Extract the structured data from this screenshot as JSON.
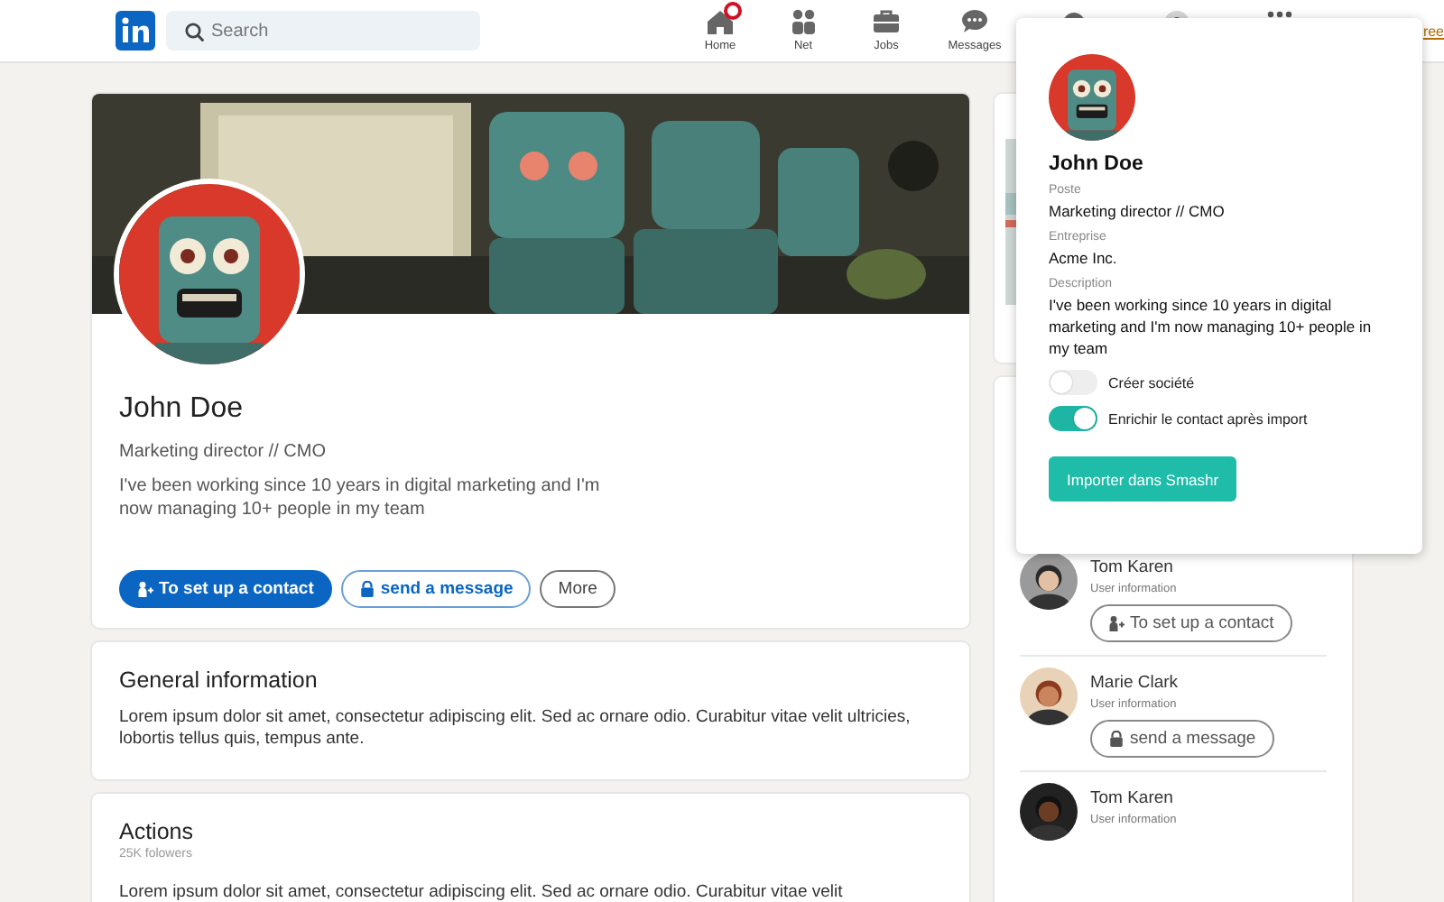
{
  "topbar": {
    "search": {
      "placeholder": "Search"
    },
    "nav_items": [
      {
        "kind": "home",
        "label": "Home",
        "notification": true
      },
      {
        "kind": "people",
        "label": "Net",
        "notification": false
      },
      {
        "kind": "briefcase",
        "label": "Jobs",
        "notification": false
      },
      {
        "kind": "chat",
        "label": "Messages",
        "notification": false
      },
      {
        "kind": "dot",
        "notification": false
      },
      {
        "kind": "avatar",
        "notification": false
      },
      {
        "kind": "grid",
        "notification": false
      }
    ],
    "link": "ree"
  },
  "profile": {
    "name": "John Doe",
    "headline": "Marketing director // CMO",
    "about": "I've been working since 10 years in digital marketing and I'm now managing 10+ people in my team",
    "buttons": [
      {
        "kind": "primary",
        "label": "To set up a contact"
      },
      {
        "kind": "outline",
        "label": "send a message"
      },
      {
        "kind": "plain",
        "label": "More"
      }
    ]
  },
  "sections": [
    {
      "title": "General information",
      "text": "Lorem ipsum dolor sit amet, consectetur adipiscing elit. Sed ac ornare odio. Curabitur vitae velit ultricies, lobortis tellus quis, tempus ante."
    },
    {
      "title": "Actions",
      "subtitle": "25K folowers",
      "text": "Lorem ipsum dolor sit amet, consectetur adipiscing elit. Sed ac ornare odio. Curabitur vitae velit"
    }
  ],
  "people": [
    {
      "name": "Tom Karen",
      "info": "User information",
      "button": {
        "kind": "contact",
        "label": "To set up a contact"
      }
    },
    {
      "name": "Marie Clark",
      "info": "User information",
      "button": {
        "kind": "message",
        "label": "send a message"
      }
    },
    {
      "name": "Tom Karen",
      "info": "User information"
    }
  ],
  "popup": {
    "name": "John Doe",
    "fields": [
      {
        "label": "Poste",
        "value": "Marketing director // CMO"
      },
      {
        "label": "Entreprise",
        "value": "Acme Inc."
      },
      {
        "label": "Description",
        "value": "I've been working since 10 years in digital marketing and I'm now managing 10+ people in my team"
      }
    ],
    "toggles": [
      {
        "label": "Créer société",
        "on": false
      },
      {
        "label": "Enrichir le contact après import",
        "on": true
      }
    ],
    "button": "Importer dans Smashr"
  }
}
